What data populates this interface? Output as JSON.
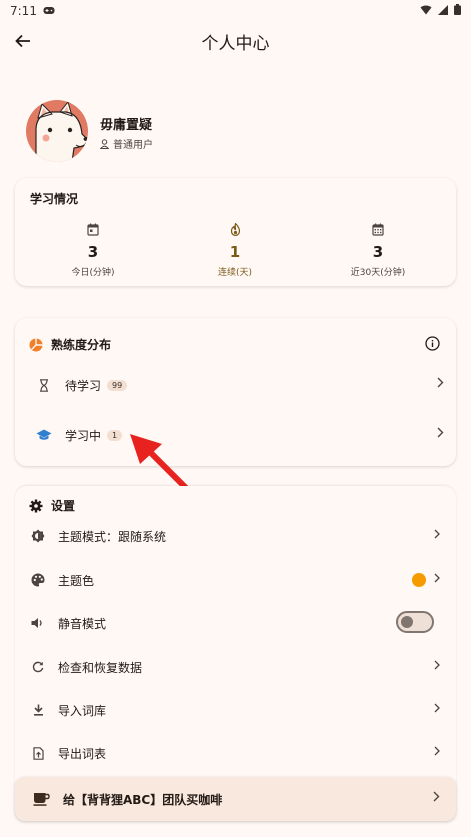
{
  "status": {
    "time": "7:11"
  },
  "appbar": {
    "title": "个人中心"
  },
  "profile": {
    "name": "毋庸置疑",
    "type": "普通用户"
  },
  "stats": {
    "title": "学习情况",
    "items": [
      {
        "value": "3",
        "label": "今日(分钟)"
      },
      {
        "value": "1",
        "label": "连续(天)"
      },
      {
        "value": "3",
        "label": "近30天(分钟)"
      }
    ]
  },
  "proficiency": {
    "title": "熟练度分布",
    "rows": [
      {
        "label": "待学习",
        "count": "99"
      },
      {
        "label": "学习中",
        "count": "1"
      }
    ]
  },
  "settings": {
    "title": "设置",
    "rows": [
      {
        "label": "主题模式：跟随系统"
      },
      {
        "label": "主题色",
        "color": "#f59b00"
      },
      {
        "label": "静音模式",
        "toggle_on": false
      },
      {
        "label": "检查和恢复数据"
      },
      {
        "label": "导入词库"
      },
      {
        "label": "导出词表"
      }
    ]
  },
  "coffee": {
    "label": "给【背背狸ABC】团队买咖啡"
  },
  "colors": {
    "accent": "#7a5a17",
    "background": "#fff8f5",
    "arrow": "#e8231f",
    "avatar_bg": "#e07a62"
  }
}
